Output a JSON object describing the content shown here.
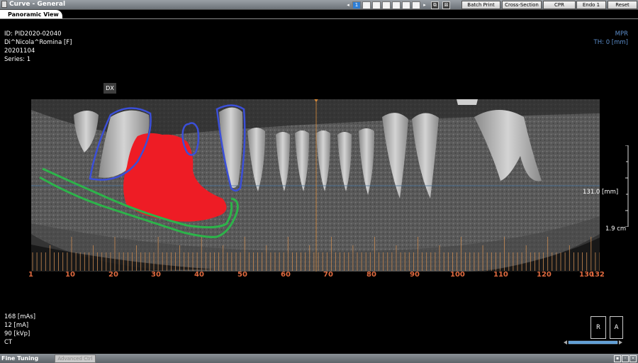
{
  "window": {
    "title": "Curve - General"
  },
  "pagination": {
    "prev": "◂",
    "current": "1",
    "next": "▸",
    "icon_a": "⧉",
    "icon_b": "⊠"
  },
  "toolbar": {
    "batch_print": "Batch Print",
    "cross_section": "Cross-Section",
    "cpr": "CPR",
    "endo": "Endo 1",
    "reset": "Reset"
  },
  "tab": {
    "label": "Panoramic View"
  },
  "patient": {
    "id": "ID: PID2020-02040",
    "name": "Di^Nicola^Romina [F]",
    "date": "20201104",
    "series": "Series: 1"
  },
  "view_info": {
    "mode": "MPR",
    "thickness": "TH: 0 [mm]"
  },
  "dx_label": "DX",
  "position_readout": "131.0 [mm]",
  "scale_readout": "1.9 cm",
  "axis": {
    "ticks": [
      "1",
      "10",
      "20",
      "30",
      "40",
      "50",
      "60",
      "70",
      "80",
      "90",
      "100",
      "110",
      "120",
      "130",
      "132"
    ]
  },
  "acquisition": {
    "mas": "168 [mAs]",
    "ma": "12 [mA]",
    "kvp": "90 [kVp]",
    "modality": "CT"
  },
  "orientation": {
    "right": "R",
    "anterior": "A"
  },
  "bottom_bar": {
    "fine_tuning": "Fine Tuning",
    "advanced": "Advanced Ctrl"
  },
  "colors": {
    "accent": "#5b8cc9",
    "axis_numbers": "#e06a3f",
    "lesion": "#ee1c25",
    "nerve": "#2db34a",
    "tooth_outline": "#3b4fd8"
  },
  "icons": {
    "tab_icon": "window-icon",
    "bottom_icons": [
      "lock-icon",
      "settings-icon",
      "close-icon"
    ]
  }
}
